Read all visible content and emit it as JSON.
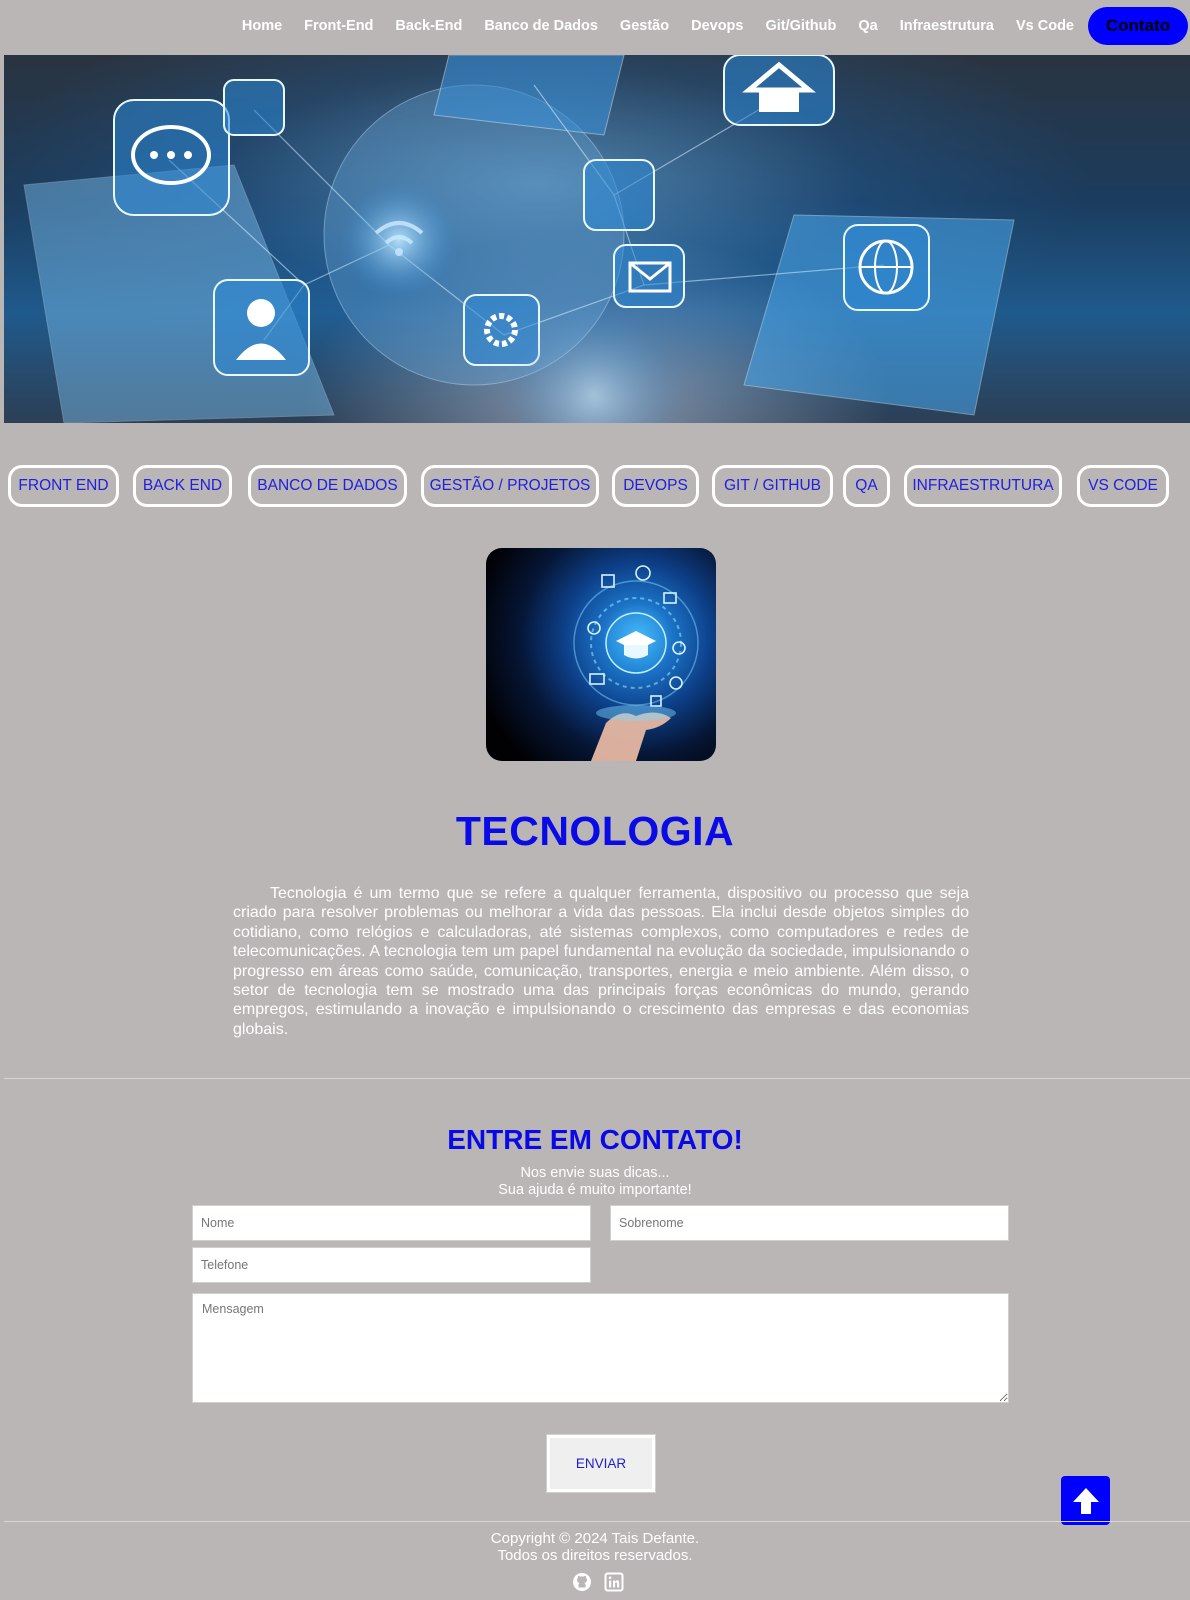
{
  "nav": {
    "links": [
      "Home",
      "Front-End",
      "Back-End",
      "Banco de Dados",
      "Gestão",
      "Devops",
      "Git/Github",
      "Qa",
      "Infraestrutura",
      "Vs Code"
    ],
    "contact_button": "Contato",
    "accent_color": "#0000ff"
  },
  "hero": {
    "icon_names": [
      "chat-bubble-icon",
      "person-icon",
      "gear-icon",
      "envelope-icon",
      "globe-icon",
      "home-icon",
      "wifi-icon",
      "shopping-cart-icon"
    ]
  },
  "categories": [
    "FRONT END",
    "BACK END",
    "BANCO DE DADOS",
    "GESTÃO / PROJETOS",
    "DEVOPS",
    "GIT / GITHUB",
    "QA",
    "INFRAESTRUTURA",
    "VS CODE"
  ],
  "main": {
    "title": "TECNOLOGIA",
    "paragraph": "Tecnologia é um termo que se refere a qualquer ferramenta, dispositivo ou processo que seja criado para resolver problemas ou melhorar a vida das pessoas. Ela inclui desde objetos simples do cotidiano, como relógios e calculadoras, até sistemas complexos, como computadores e redes de telecomunicações. A tecnologia tem um papel fundamental na evolução da sociedade, impulsionando o progresso em áreas como saúde, comunicação, transportes, energia e meio ambiente. Além disso, o setor de tecnologia tem se mostrado uma das principais forças econômicas do mundo, gerando empregos, estimulando a inovação e impulsionando o crescimento das empresas e das economias globais."
  },
  "contact": {
    "title": "ENTRE EM CONTATO!",
    "subtitle_line1": "Nos envie suas dicas...",
    "subtitle_line2": "Sua ajuda é muito importante!",
    "placeholders": {
      "nome": "Nome",
      "sobrenome": "Sobrenome",
      "telefone": "Telefone",
      "mensagem": "Mensagem"
    },
    "submit_label": "ENVIAR"
  },
  "footer": {
    "copyright_line1": "Copyright © 2024 Tais Defante.",
    "copyright_line2": "Todos os direitos reservados.",
    "social_icons": [
      "github-icon",
      "linkedin-icon"
    ]
  },
  "colors": {
    "background": "#bab6b6",
    "heading_blue": "#0a0ae6",
    "pill_text": "#2020e0"
  }
}
